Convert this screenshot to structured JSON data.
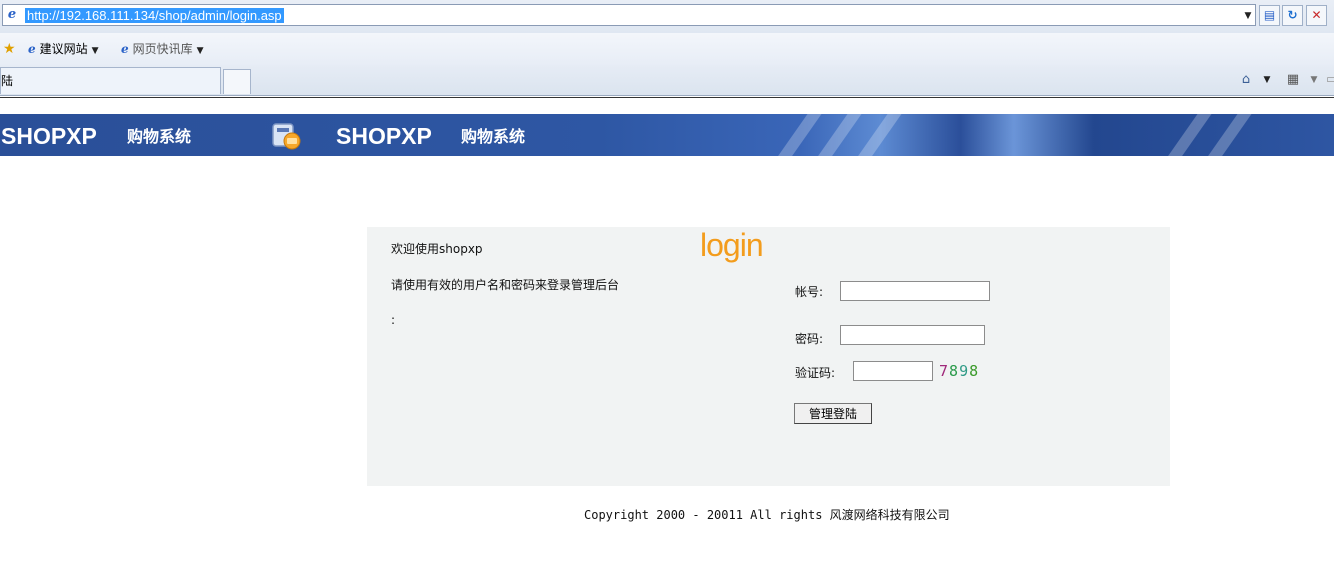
{
  "browser": {
    "url": "http://192.168.111.134/shop/admin/login.asp",
    "favorites": [
      {
        "label": "建议网站"
      },
      {
        "label": "网页快讯库"
      }
    ],
    "active_tab_title": "陆"
  },
  "banner": {
    "logo_text": "SHOPXP",
    "subtitle": "购物系统"
  },
  "login": {
    "welcome": "欢迎使用shopxp",
    "instruction": "请使用有效的用户名和密码来登录管理后台",
    "note": ":",
    "logo": "login",
    "account_label": "帐号:",
    "password_label": "密码:",
    "captcha_label": "验证码:",
    "account_value": "",
    "password_value": "",
    "captcha_value": "",
    "captcha_digits": [
      "7",
      "8",
      "9",
      "8"
    ],
    "submit_label": "管理登陆"
  },
  "footer": {
    "copyright": "Copyright 2000 - 20011 All rights 风渡网络科技有限公司"
  }
}
